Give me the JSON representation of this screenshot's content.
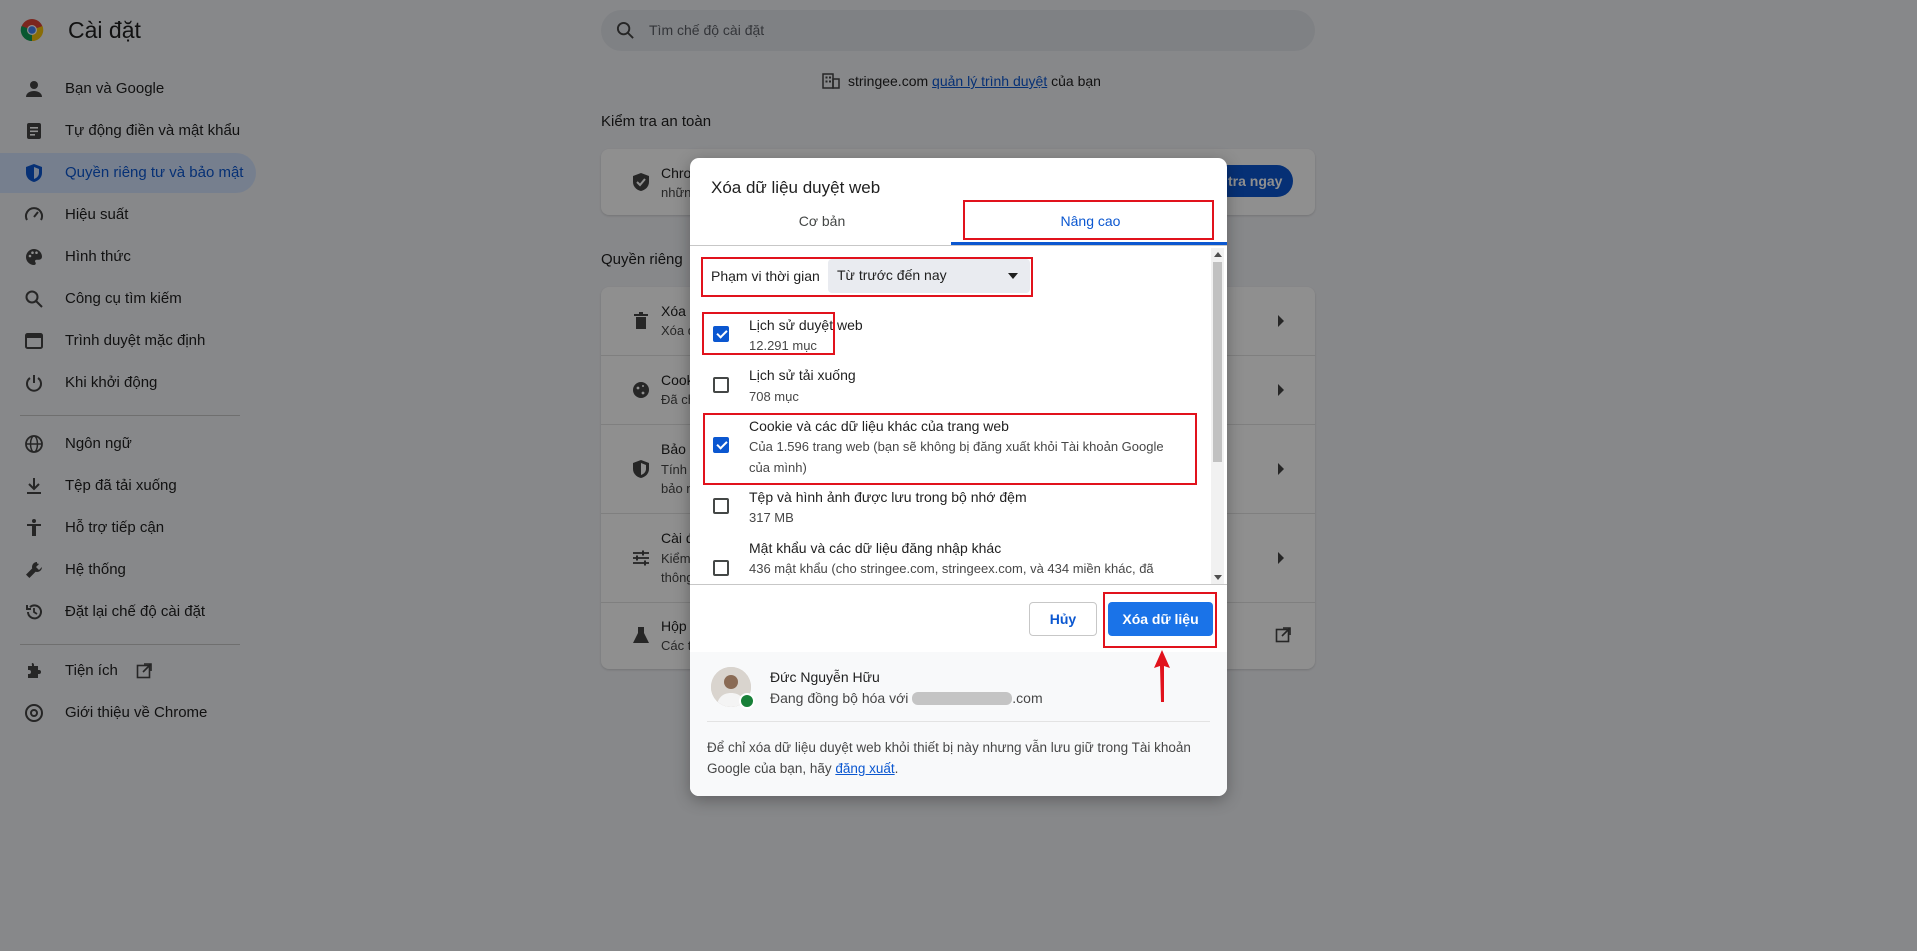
{
  "header": {
    "app_title": "Cài đặt",
    "search_placeholder": "Tìm chế độ cài đặt"
  },
  "sidebar": {
    "items": [
      {
        "label": "Bạn và Google",
        "icon": "person-icon"
      },
      {
        "label": "Tự động điền và mật khẩu",
        "icon": "clipboard-icon"
      },
      {
        "label": "Quyền riêng tư và bảo mật",
        "icon": "shield-icon",
        "active": true
      },
      {
        "label": "Hiệu suất",
        "icon": "speedometer-icon"
      },
      {
        "label": "Hình thức",
        "icon": "palette-icon"
      },
      {
        "label": "Công cụ tìm kiếm",
        "icon": "search-icon"
      },
      {
        "label": "Trình duyệt mặc định",
        "icon": "browser-icon"
      },
      {
        "label": "Khi khởi động",
        "icon": "power-icon"
      },
      {
        "label": "Ngôn ngữ",
        "icon": "globe-icon"
      },
      {
        "label": "Tệp đã tải xuống",
        "icon": "download-icon"
      },
      {
        "label": "Hỗ trợ tiếp cận",
        "icon": "accessibility-icon"
      },
      {
        "label": "Hệ thống",
        "icon": "wrench-icon"
      },
      {
        "label": "Đặt lại chế độ cài đặt",
        "icon": "reset-icon"
      },
      {
        "label": "Tiện ích",
        "icon": "puzzle-icon"
      },
      {
        "label": "Giới thiệu về Chrome",
        "icon": "chrome-icon"
      }
    ]
  },
  "main": {
    "managed": {
      "domain": "stringee.com",
      "link": "quản lý trình duyệt",
      "suffix": "của bạn"
    },
    "safety_heading": "Kiểm tra an toàn",
    "safety_row": {
      "title": "Chro",
      "sub": "nhữn",
      "button": "tra ngay"
    },
    "privacy_heading": "Quyền riêng",
    "privacy_rows": [
      {
        "title": "Xóa d",
        "sub": "Xóa d"
      },
      {
        "title": "Cook",
        "sub": "Đã ch"
      },
      {
        "title": "Bảo m",
        "sub": "Tính",
        "sub2": "bảo m"
      },
      {
        "title": "Cài đ",
        "sub": "Kiểm",
        "sub2": "thông"
      },
      {
        "title": "Hộp",
        "sub": "Các t"
      }
    ]
  },
  "dialog": {
    "title": "Xóa dữ liệu duyệt web",
    "tabs": [
      "Cơ bản",
      "Nâng cao"
    ],
    "time_range_label": "Phạm vi thời gian",
    "time_range_value": "Từ trước đến nay",
    "items": [
      {
        "title": "Lịch sử duyệt web",
        "sub": "12.291 mục",
        "checked": true
      },
      {
        "title": "Lịch sử tải xuống",
        "sub": "708 mục",
        "checked": false
      },
      {
        "title": "Cookie và các dữ liệu khác của trang web",
        "sub": "Của 1.596 trang web (bạn sẽ không bị đăng xuất khỏi Tài khoản Google của mình)",
        "checked": true
      },
      {
        "title": "Tệp và hình ảnh được lưu trong bộ nhớ đệm",
        "sub": "317 MB",
        "checked": false
      },
      {
        "title": "Mật khẩu và các dữ liệu đăng nhập khác",
        "sub": "436 mật khẩu (cho stringee.com, stringeex.com, và 434 miền khác, đã",
        "checked": false
      }
    ],
    "cancel_label": "Hủy",
    "clear_label": "Xóa dữ liệu",
    "account": {
      "name": "Đức Nguyễn Hữu",
      "sync_prefix": "Đang đồng bộ hóa với",
      "sync_suffix": ".com"
    },
    "info": {
      "text": "Để chỉ xóa dữ liệu duyệt web khỏi thiết bị này nhưng vẫn lưu giữ trong Tài khoản Google của bạn, hãy",
      "link": "đăng xuất",
      "end": "."
    }
  },
  "colors": {
    "accent": "#0b57d0",
    "highlight": "#e1121c",
    "primary_button": "#1a73e8"
  }
}
